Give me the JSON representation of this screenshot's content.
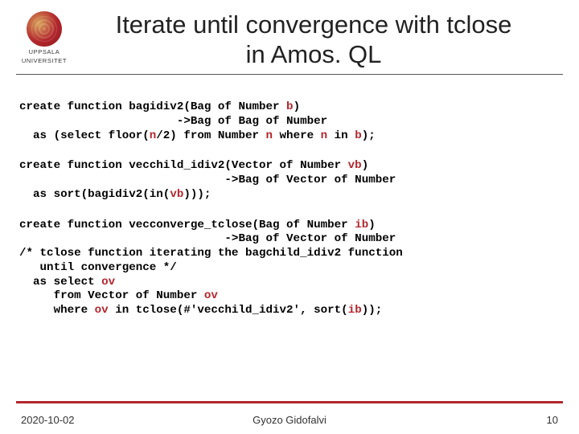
{
  "logo": {
    "university": "UPPSALA",
    "sub": "UNIVERSITET"
  },
  "title_line1": "Iterate until convergence with tclose",
  "title_line2": "in Amos. QL",
  "code": {
    "b1_l1a": "create function bagidiv2(Bag of Number ",
    "b1_l1v": "b",
    "b1_l1b": ")",
    "b1_l2": "                       ->Bag of Bag of Number",
    "b1_l3a": "  as (select floor(",
    "b1_l3v": "n",
    "b1_l3b": "/2) from Number ",
    "b1_l3c": "n",
    "b1_l3d": " where ",
    "b1_l3e": "n",
    "b1_l3f": " in ",
    "b1_l3g": "b",
    "b1_l3h": ");",
    "b2_l1a": "create function vecchild_idiv2(Vector of Number ",
    "b2_l1v": "vb",
    "b2_l1b": ")",
    "b2_l2": "                              ->Bag of Vector of Number",
    "b2_l3a": "  as sort(bagidiv2(in(",
    "b2_l3v": "vb",
    "b2_l3b": ")));",
    "b3_l1a": "create function vecconverge_tclose(Bag of Number ",
    "b3_l1v": "ib",
    "b3_l1b": ")",
    "b3_l2": "                              ->Bag of Vector of Number",
    "b3_l3": "/* tclose function iterating the bagchild_idiv2 function",
    "b3_l4": "   until convergence */",
    "b3_l5a": "  as select ",
    "b3_l5v": "ov",
    "b3_l6a": "     from Vector of Number ",
    "b3_l6v": "ov",
    "b3_l7a": "     where ",
    "b3_l7v": "ov",
    "b3_l7b": " in tclose(#'vecchild_idiv2', sort(",
    "b3_l7c": "ib",
    "b3_l7d": "));"
  },
  "footer": {
    "date": "2020-10-02",
    "author": "Gyozo Gidofalvi",
    "page": "10"
  }
}
